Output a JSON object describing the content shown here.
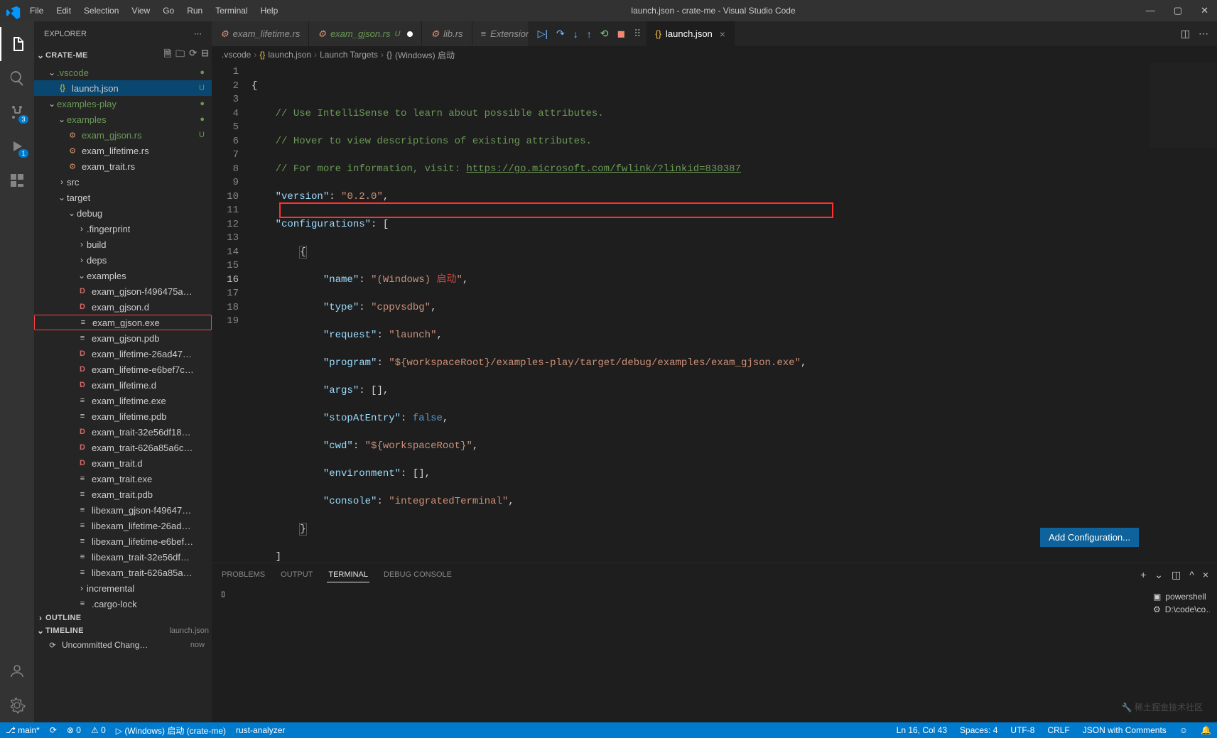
{
  "window": {
    "title": "launch.json - crate-me - Visual Studio Code"
  },
  "menu": [
    "File",
    "Edit",
    "Selection",
    "View",
    "Go",
    "Run",
    "Terminal",
    "Help"
  ],
  "win_controls": {
    "min": "—",
    "max": "▢",
    "close": "✕"
  },
  "activity_badges": {
    "scm": "3",
    "debug": "1"
  },
  "sidebar": {
    "title": "EXPLORER",
    "project": "CRATE-ME",
    "outline": "OUTLINE",
    "timeline": "TIMELINE",
    "timeline_file": "launch.json",
    "timeline_item": "Uncommitted Chang…",
    "timeline_when": "now"
  },
  "tree": {
    "vscode": ".vscode",
    "launch": "launch.json",
    "launch_status": "U",
    "examples_play": "examples-play",
    "examples": "examples",
    "exam_gjson_rs": "exam_gjson.rs",
    "exam_gjson_rs_status": "U",
    "exam_lifetime_rs": "exam_lifetime.rs",
    "exam_trait_rs": "exam_trait.rs",
    "src": "src",
    "target": "target",
    "debug": "debug",
    "fingerprint": ".fingerprint",
    "build": "build",
    "deps": "deps",
    "examples2": "examples",
    "f_exam_gjson_hash": "exam_gjson-f496475a…",
    "f_exam_gjson_d": "exam_gjson.d",
    "f_exam_gjson_exe": "exam_gjson.exe",
    "f_exam_gjson_pdb": "exam_gjson.pdb",
    "f_exam_lifetime_hash1": "exam_lifetime-26ad47…",
    "f_exam_lifetime_hash2": "exam_lifetime-e6bef7c…",
    "f_exam_lifetime_d": "exam_lifetime.d",
    "f_exam_lifetime_exe": "exam_lifetime.exe",
    "f_exam_lifetime_pdb": "exam_lifetime.pdb",
    "f_exam_trait_hash1": "exam_trait-32e56df18…",
    "f_exam_trait_hash2": "exam_trait-626a85a6c…",
    "f_exam_trait_d": "exam_trait.d",
    "f_exam_trait_exe": "exam_trait.exe",
    "f_exam_trait_pdb": "exam_trait.pdb",
    "f_libexam_gjson": "libexam_gjson-f49647…",
    "f_libexam_lifetime1": "libexam_lifetime-26ad…",
    "f_libexam_lifetime2": "libexam_lifetime-e6bef…",
    "f_libexam_trait1": "libexam_trait-32e56df…",
    "f_libexam_trait2": "libexam_trait-626a85a…",
    "incremental": "incremental",
    "cargo_lock": ".cargo-lock"
  },
  "tabs": {
    "exam_lifetime": "exam_lifetime.rs",
    "exam_gjson": "exam_gjson.rs",
    "exam_gjson_status": "U",
    "lib": "lib.rs",
    "extension": "Extension:",
    "launch": "launch.json"
  },
  "breadcrumb": {
    "p1": ".vscode",
    "p2": "launch.json",
    "p3": "Launch Targets",
    "p4": "(Windows) 启动"
  },
  "code": {
    "c1": "// Use IntelliSense to learn about possible attributes.",
    "c2": "// Hover to view descriptions of existing attributes.",
    "c3a": "// For more information, visit: ",
    "c3b": "https://go.microsoft.com/fwlink/?linkid=830387",
    "version_k": "\"version\"",
    "version_v": "\"0.2.0\"",
    "config_k": "\"configurations\"",
    "name_k": "\"name\"",
    "name_v1": "\"(Windows) ",
    "name_v2": "启动",
    "name_v3": "\"",
    "type_k": "\"type\"",
    "type_v": "\"cppvsdbg\"",
    "request_k": "\"request\"",
    "request_v": "\"launch\"",
    "program_k": "\"program\"",
    "program_v": "\"${workspaceRoot}/examples-play/target/debug/examples/exam_gjson.exe\"",
    "args_k": "\"args\"",
    "stop_k": "\"stopAtEntry\"",
    "stop_v": "false",
    "cwd_k": "\"cwd\"",
    "cwd_v": "\"${workspaceRoot}\"",
    "env_k": "\"environment\"",
    "console_k": "\"console\"",
    "console_v": "\"integratedTerminal\""
  },
  "line_numbers": [
    "1",
    "2",
    "3",
    "4",
    "5",
    "6",
    "7",
    "8",
    "9",
    "10",
    "11",
    "12",
    "13",
    "14",
    "15",
    "16",
    "17",
    "18",
    "19"
  ],
  "add_config": "Add Configuration...",
  "panel": {
    "problems": "PROBLEMS",
    "output": "OUTPUT",
    "terminal": "TERMINAL",
    "debug_console": "DEBUG CONSOLE",
    "term_prompt": "▯",
    "side1": "powershell",
    "side2": "D:\\code\\co…"
  },
  "status": {
    "branch": "main*",
    "sync": "⟳",
    "errors": "⊗ 0",
    "warnings": "⚠ 0",
    "launch": "▷ (Windows) 启动 (crate-me)",
    "rust": "rust-analyzer",
    "lncol": "Ln 16, Col 43",
    "spaces": "Spaces: 4",
    "encoding": "UTF-8",
    "eol": "CRLF",
    "lang": "JSON with Comments",
    "feedback": "☺",
    "bell": "🔔"
  },
  "watermark": "稀土掘金技术社区",
  "chart_data": null
}
